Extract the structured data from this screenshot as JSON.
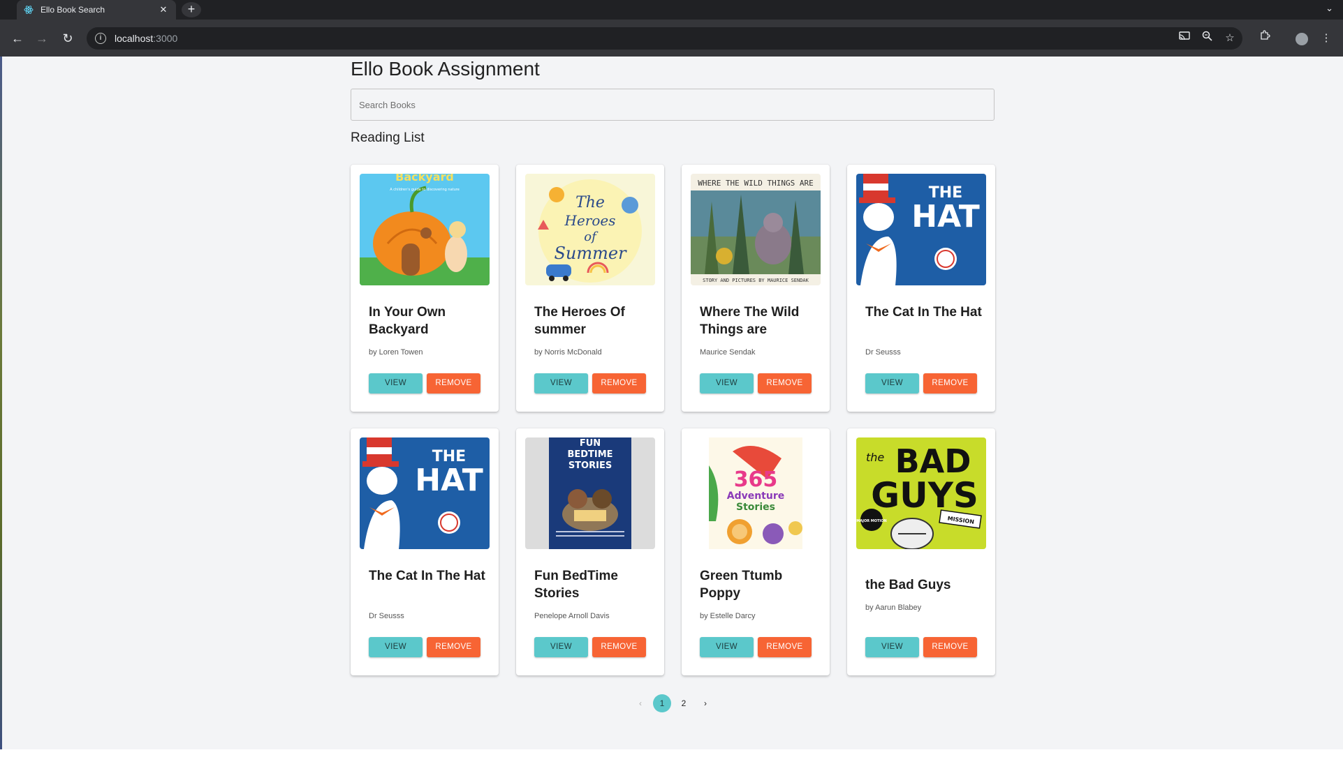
{
  "browser": {
    "tab_title": "Ello Book Search",
    "tab_close": "✕",
    "new_tab": "+",
    "tab_menu": "⌄",
    "url_host": "localhost",
    "url_port": ":3000",
    "nav": {
      "back": "←",
      "forward": "→",
      "reload": "↻"
    },
    "icons": [
      "cast-icon",
      "zoom-icon",
      "bookmark-star-icon",
      "extensions-icon",
      "profile-avatar",
      "kebab-menu-icon"
    ]
  },
  "page": {
    "title": "Ello Book Assignment",
    "search_placeholder": "Search Books",
    "section_title": "Reading List"
  },
  "books": [
    {
      "title": "In Your Own Backyard",
      "author": "by Loren Towen",
      "cover": "pumpkin-house-cover"
    },
    {
      "title": "The Heroes Of summer",
      "author": "by Norris McDonald",
      "cover": "heroes-of-summer-cover"
    },
    {
      "title": "Where The Wild Things are",
      "author": "Maurice Sendak",
      "cover": "wild-things-cover"
    },
    {
      "title": "The Cat In The Hat",
      "author": "Dr Seusss",
      "cover": "cat-in-hat-cover"
    },
    {
      "title": "The Cat In The Hat",
      "author": "Dr Seusss",
      "cover": "cat-in-hat-cover"
    },
    {
      "title": "Fun BedTime Stories",
      "author": "Penelope Arnoll Davis",
      "cover": "bedtime-stories-cover"
    },
    {
      "title": "Green Ttumb Poppy",
      "author": "by Estelle Darcy",
      "cover": "365-adventure-cover"
    },
    {
      "title": "the Bad Guys",
      "author": "by Aarun Blabey",
      "cover": "bad-guys-cover"
    }
  ],
  "buttons": {
    "view": "VIEW",
    "remove": "REMOVE"
  },
  "pagination": {
    "prev": "‹",
    "pages": [
      "1",
      "2"
    ],
    "next": "›",
    "current": "1"
  },
  "colors": {
    "view_button": "#5bc8cb",
    "remove_button": "#f76434",
    "page_bg": "#f3f4f6"
  }
}
